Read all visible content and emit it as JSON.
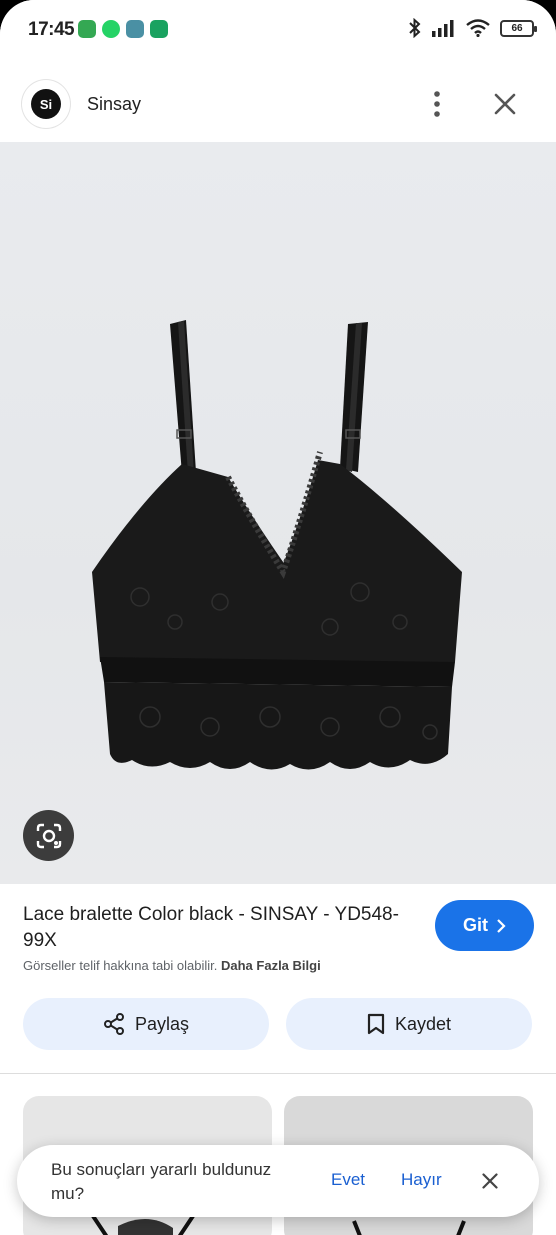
{
  "status_bar": {
    "time": "17:45",
    "battery": "66",
    "notif_icons": [
      "phone-app-icon",
      "whatsapp-icon",
      "maps-icon",
      "sync-app-icon"
    ],
    "notif_colors": [
      "#34a853",
      "#25d366",
      "#4a90a4",
      "#1aa260"
    ]
  },
  "header": {
    "site_name": "Sinsay",
    "logo_text": "Si"
  },
  "product": {
    "title": "Lace bralette Color black - SINSAY - YD548-99X",
    "go_label": "Git",
    "copyright": "Görseller telif hakkına tabi olabilir.",
    "more_info": "Daha Fazla Bilgi",
    "share_label": "Paylaş",
    "save_label": "Kaydet"
  },
  "feedback": {
    "question": "Bu sonuçları yararlı buldunuz mu?",
    "yes": "Evet",
    "no": "Hayır"
  },
  "colors": {
    "accent": "#1a73e8",
    "action_bg": "#e8f0fd",
    "link": "#1a5fd1"
  }
}
